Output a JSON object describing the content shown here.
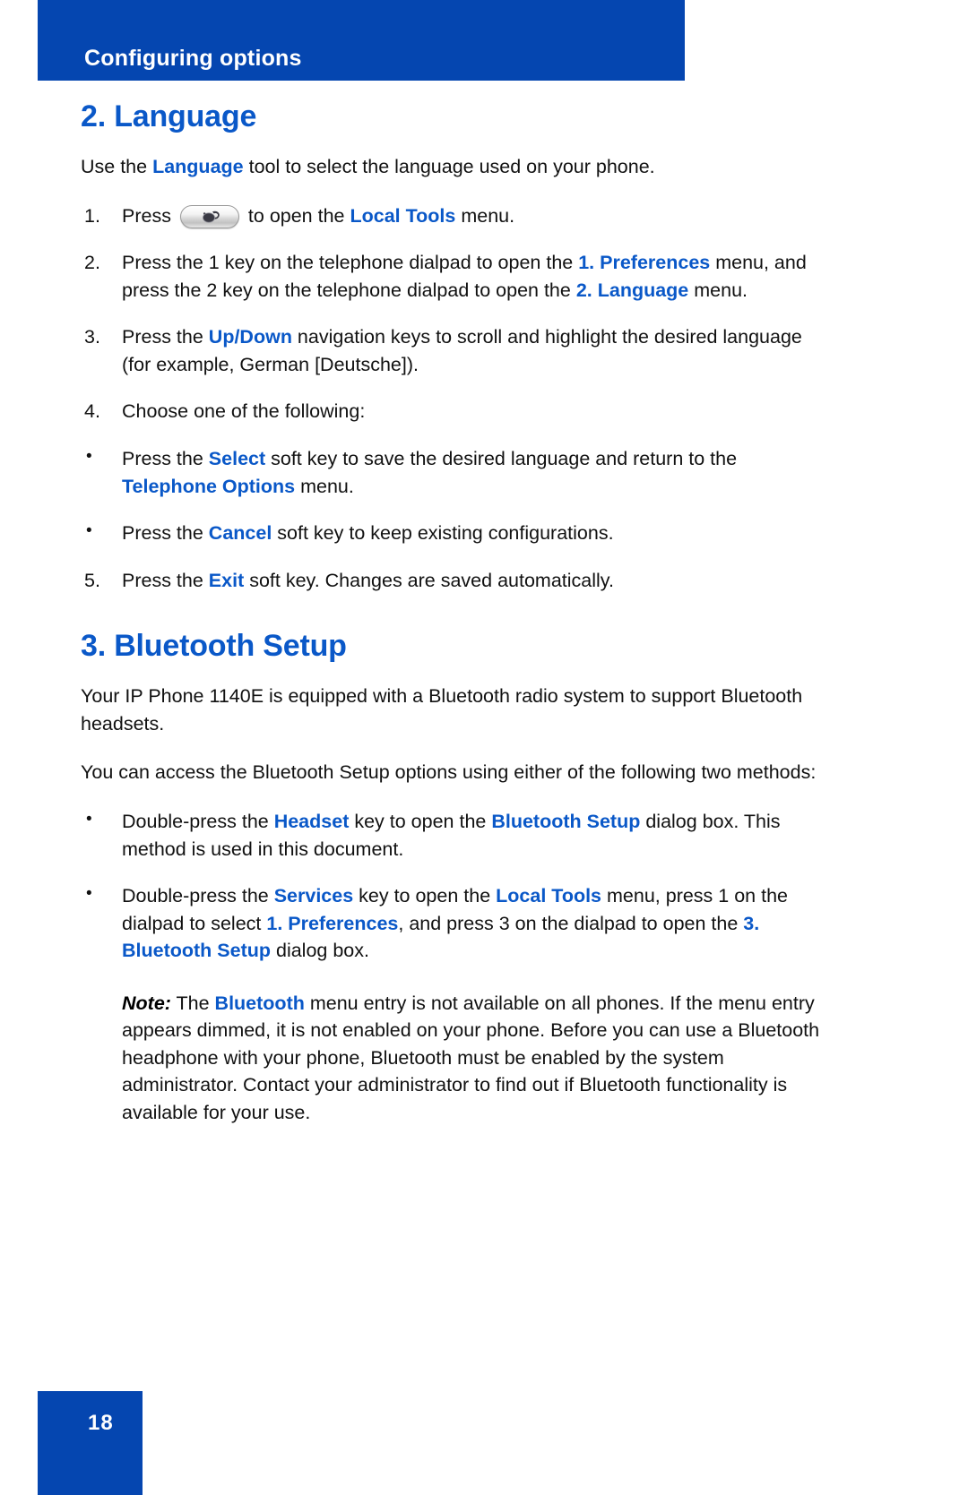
{
  "header": {
    "title": "Configuring options",
    "band_color": "#0546B0"
  },
  "accent_color": "#0A58C8",
  "sections": [
    {
      "heading": "2. Language",
      "intro": {
        "pre": "Use the ",
        "kw": "Language",
        "post": " tool to select the language used on your phone."
      },
      "steps": [
        {
          "marker": "1.",
          "type": "numbered",
          "parts": [
            {
              "text": "Press ",
              "style": "plain"
            },
            {
              "text": "services-key-icon",
              "style": "icon"
            },
            {
              "text": " to open the ",
              "style": "plain"
            },
            {
              "text": "Local Tools",
              "style": "keyword"
            },
            {
              "text": " menu.",
              "style": "plain"
            }
          ]
        },
        {
          "marker": "2.",
          "type": "numbered",
          "parts": [
            {
              "text": "Press the 1 key on the telephone dialpad to open the ",
              "style": "plain"
            },
            {
              "text": "1. Preferences",
              "style": "keyword"
            },
            {
              "text": " menu, and press the 2 key on the telephone dialpad to open the ",
              "style": "plain"
            },
            {
              "text": "2. Language",
              "style": "keyword"
            },
            {
              "text": " menu.",
              "style": "plain"
            }
          ]
        },
        {
          "marker": "3.",
          "type": "numbered",
          "parts": [
            {
              "text": "Press the ",
              "style": "plain"
            },
            {
              "text": "Up/Down",
              "style": "keyword"
            },
            {
              "text": " navigation keys to scroll and highlight the desired language (for example, German [Deutsche]).",
              "style": "plain"
            }
          ]
        },
        {
          "marker": "4.",
          "type": "numbered",
          "parts": [
            {
              "text": "Choose one of the following:",
              "style": "plain"
            }
          ]
        },
        {
          "marker": "•",
          "type": "bullet",
          "parts": [
            {
              "text": "Press the ",
              "style": "plain"
            },
            {
              "text": "Select",
              "style": "keyword"
            },
            {
              "text": " soft key to save the desired language and return to the ",
              "style": "plain"
            },
            {
              "text": "Telephone Options",
              "style": "keyword"
            },
            {
              "text": " menu.",
              "style": "plain"
            }
          ]
        },
        {
          "marker": "•",
          "type": "bullet",
          "parts": [
            {
              "text": "Press the ",
              "style": "plain"
            },
            {
              "text": "Cancel",
              "style": "keyword"
            },
            {
              "text": " soft key to keep existing configurations.",
              "style": "plain"
            }
          ]
        },
        {
          "marker": "5.",
          "type": "numbered",
          "parts": [
            {
              "text": "Press the ",
              "style": "plain"
            },
            {
              "text": "Exit",
              "style": "keyword"
            },
            {
              "text": " soft key. Changes are saved automatically.",
              "style": "plain"
            }
          ]
        }
      ]
    },
    {
      "heading": "3. Bluetooth Setup",
      "paragraphs": [
        "Your IP Phone 1140E is equipped with a Bluetooth radio system to support Bluetooth headsets.",
        "You can access the Bluetooth Setup options using either of the following two methods:"
      ],
      "steps": [
        {
          "marker": "•",
          "type": "bullet",
          "parts": [
            {
              "text": "Double-press the ",
              "style": "plain"
            },
            {
              "text": "Headset",
              "style": "keyword"
            },
            {
              "text": " key to open the ",
              "style": "plain"
            },
            {
              "text": "Bluetooth Setup",
              "style": "keyword"
            },
            {
              "text": " dialog box. This method is used in this document.",
              "style": "plain"
            }
          ]
        },
        {
          "marker": "•",
          "type": "bullet",
          "parts": [
            {
              "text": "Double-press the ",
              "style": "plain"
            },
            {
              "text": "Services",
              "style": "keyword"
            },
            {
              "text": " key to open the ",
              "style": "plain"
            },
            {
              "text": "Local Tools",
              "style": "keyword"
            },
            {
              "text": " menu, press 1 on the dialpad to select ",
              "style": "plain"
            },
            {
              "text": "1. Preferences",
              "style": "keyword"
            },
            {
              "text": ", and press 3 on the dialpad to open the ",
              "style": "plain"
            },
            {
              "text": "3. Bluetooth Setup",
              "style": "keyword"
            },
            {
              "text": " dialog box.",
              "style": "plain"
            }
          ]
        }
      ],
      "note": {
        "lead": "Note:",
        "parts": [
          {
            "text": " The ",
            "style": "plain"
          },
          {
            "text": "Bluetooth",
            "style": "keyword"
          },
          {
            "text": " menu entry is not available on all phones. If the menu entry appears dimmed, it is not enabled on your phone. Before you can use a Bluetooth headphone with your phone, Bluetooth must be enabled by the system administrator. Contact your administrator to find out if Bluetooth functionality is available for your use.",
            "style": "plain"
          }
        ]
      }
    }
  ],
  "footer": {
    "page_number": "18",
    "box_color": "#0546B0"
  }
}
